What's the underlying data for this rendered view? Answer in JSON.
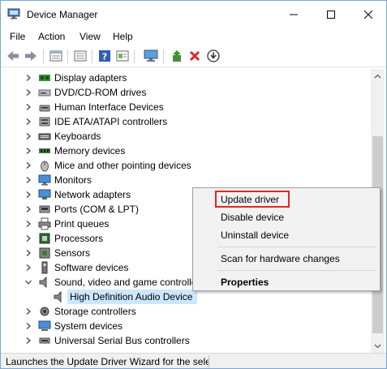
{
  "window": {
    "title": "Device Manager"
  },
  "menu": [
    "File",
    "Action",
    "View",
    "Help"
  ],
  "toolbar": [
    "back-icon",
    "forward-icon",
    "properties-sheet-icon",
    "console-icon",
    "help-icon",
    "show-hidden-icon",
    "monitor-scan-icon",
    "update-driver-icon",
    "uninstall-icon",
    "download-icon"
  ],
  "tree": {
    "items": [
      {
        "label": "Display adapters",
        "icon": "display-adapter-icon"
      },
      {
        "label": "DVD/CD-ROM drives",
        "icon": "dvd-drive-icon"
      },
      {
        "label": "Human Interface Devices",
        "icon": "hid-icon"
      },
      {
        "label": "IDE ATA/ATAPI controllers",
        "icon": "ide-controller-icon"
      },
      {
        "label": "Keyboards",
        "icon": "keyboard-icon"
      },
      {
        "label": "Memory devices",
        "icon": "memory-icon"
      },
      {
        "label": "Mice and other pointing devices",
        "icon": "mouse-icon"
      },
      {
        "label": "Monitors",
        "icon": "monitor-icon"
      },
      {
        "label": "Network adapters",
        "icon": "network-adapter-icon"
      },
      {
        "label": "Ports (COM & LPT)",
        "icon": "port-icon"
      },
      {
        "label": "Print queues",
        "icon": "printer-icon"
      },
      {
        "label": "Processors",
        "icon": "processor-icon"
      },
      {
        "label": "Sensors",
        "icon": "sensor-icon"
      },
      {
        "label": "Software devices",
        "icon": "software-device-icon"
      },
      {
        "label": "Sound, video and game controllers",
        "icon": "speaker-icon"
      },
      {
        "label": "High Definition Audio Device",
        "icon": "speaker-icon"
      },
      {
        "label": "Storage controllers",
        "icon": "storage-controller-icon"
      },
      {
        "label": "System devices",
        "icon": "system-device-icon"
      },
      {
        "label": "Universal Serial Bus controllers",
        "icon": "usb-icon"
      }
    ]
  },
  "context_menu": {
    "items": [
      "Update driver",
      "Disable device",
      "Uninstall device",
      "Scan for hardware changes",
      "Properties"
    ],
    "highlight_color": "#e0262a"
  },
  "status": {
    "text": "Launches the Update Driver Wizard for the selected device."
  },
  "colors": {
    "selection": "#cce8ff",
    "accent": "#0078d7"
  }
}
